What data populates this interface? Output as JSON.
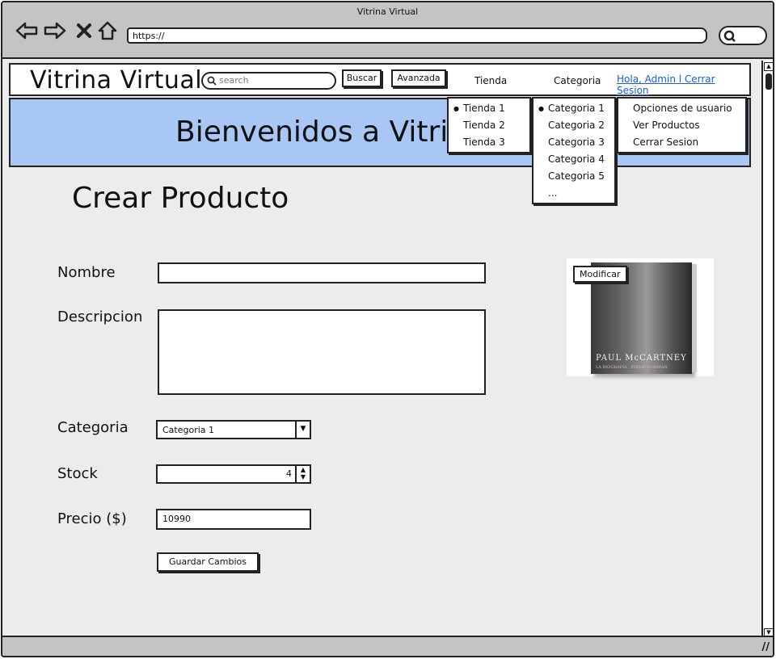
{
  "window": {
    "title": "Vitrina Virtual",
    "url": "https://"
  },
  "header": {
    "logo": "Vitrina Virtual",
    "search_placeholder": "search",
    "buscar_label": "Buscar",
    "avanzada_label": "Avanzada",
    "menu_tienda": "Tienda",
    "menu_categoria": "Categoria",
    "user_link": "Hola, Admin l Cerrar Sesion"
  },
  "banner": {
    "text": "Bienvenidos a Vitrina Virtual"
  },
  "dropdowns": {
    "tienda": [
      "Tienda 1",
      "Tienda 2",
      "Tienda 3"
    ],
    "categoria": [
      "Categoria 1",
      "Categoria 2",
      "Categoria 3",
      "Categoria 4",
      "Categoria 5",
      "..."
    ],
    "user": [
      "Opciones de usuario",
      "Ver Productos",
      "Cerrar Sesion"
    ]
  },
  "form": {
    "title": "Crear Producto",
    "nombre_label": "Nombre",
    "nombre_value": "",
    "descripcion_label": "Descripcion",
    "descripcion_value": "",
    "categoria_label": "Categoria",
    "categoria_value": "Categoria 1",
    "stock_label": "Stock",
    "stock_value": "4",
    "precio_label": "Precio ($)",
    "precio_value": "10990",
    "save_label": "Guardar Cambios"
  },
  "image": {
    "modify_label": "Modificar",
    "book_title": "PAUL McCARTNEY",
    "book_subtitle": "LA BIOGRAFIA · PHILIP NORMAN"
  },
  "colors": {
    "banner": "#a9c7f5",
    "link": "#1a5bd6",
    "chrome": "#c4c4c4"
  }
}
